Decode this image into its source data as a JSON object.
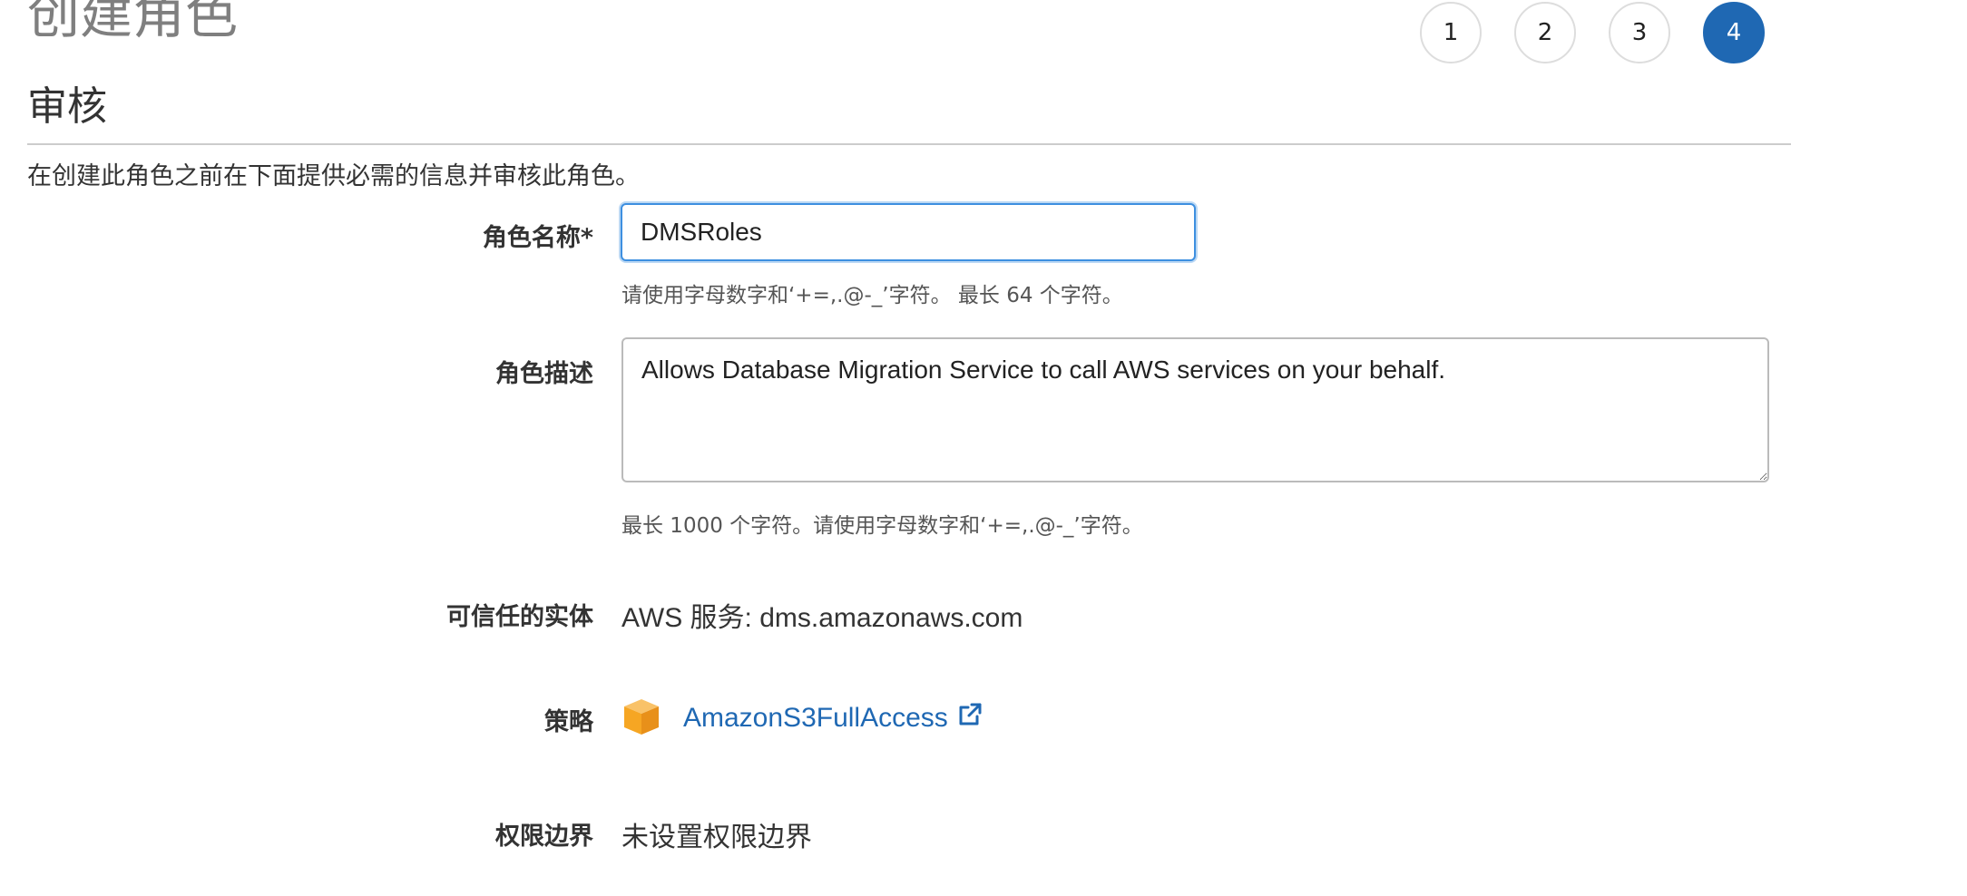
{
  "header": {
    "title": "创建角色",
    "steps": [
      "1",
      "2",
      "3",
      "4"
    ],
    "active_step": "4"
  },
  "section": {
    "title": "审核",
    "intro": "在创建此角色之前在下面提供必需的信息并审核此角色。"
  },
  "form": {
    "role_name": {
      "label": "角色名称*",
      "value": "DMSRoles",
      "hint": "请使用字母数字和‘+=,.@-_’字符。 最长 64 个字符。"
    },
    "role_description": {
      "label": "角色描述",
      "value": "Allows Database Migration Service to call AWS services on your behalf.",
      "hint": "最长 1000 个字符。请使用字母数字和‘+=,.@-_’字符。"
    },
    "trusted_entity": {
      "label": "可信任的实体",
      "value": "AWS 服务: dms.amazonaws.com"
    },
    "policies": {
      "label": "策略",
      "items": [
        {
          "name": "AmazonS3FullAccess",
          "icon": "policy-box-icon"
        }
      ]
    },
    "permissions_boundary": {
      "label": "权限边界",
      "value": "未设置权限边界"
    }
  },
  "colors": {
    "accent": "#1f68b3",
    "focus_border": "#3d8fe0",
    "policy_icon": "#f6a623"
  }
}
